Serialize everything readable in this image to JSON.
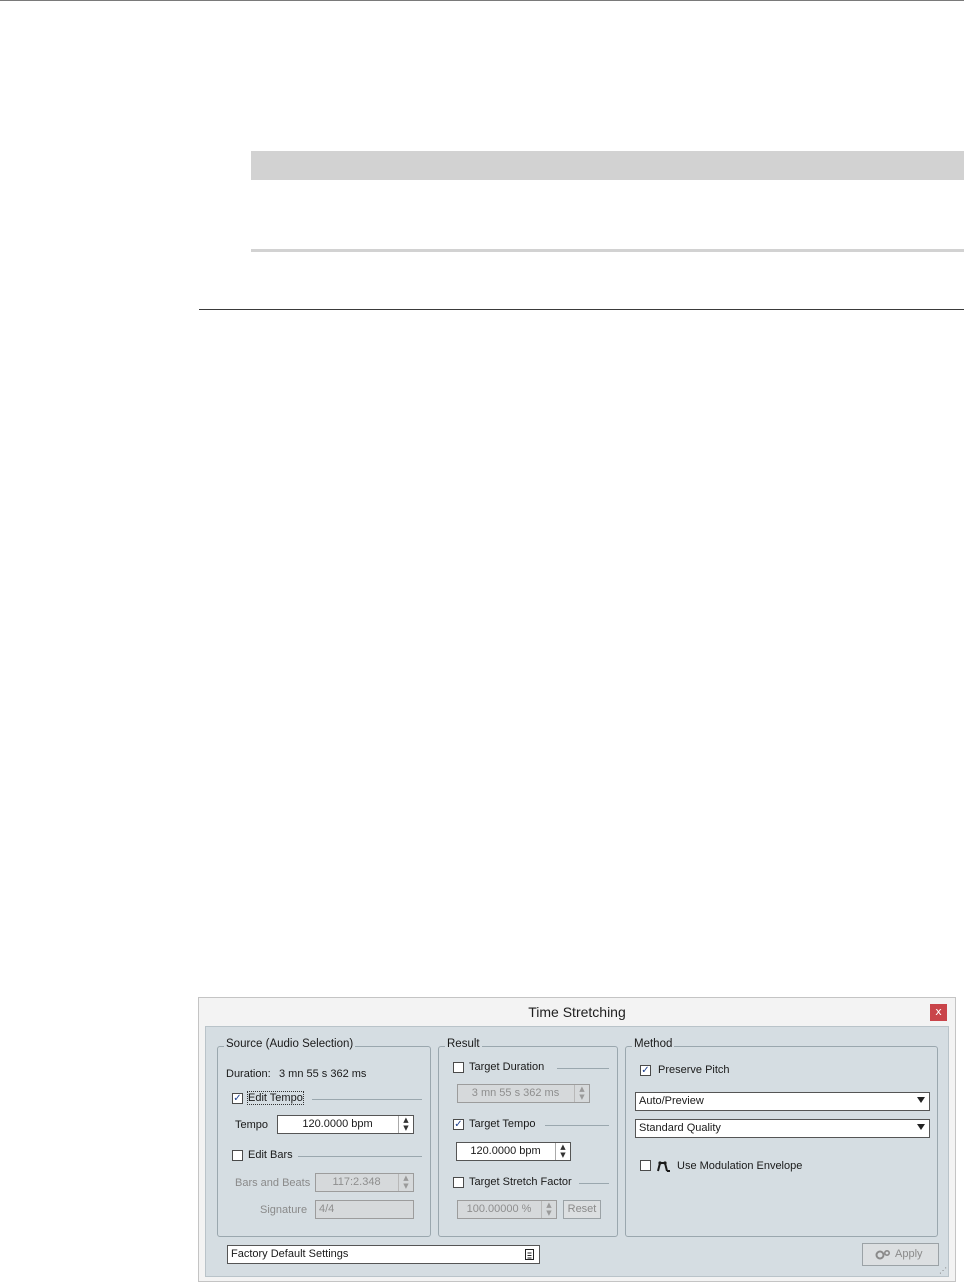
{
  "dialog": {
    "title": "Time Stretching",
    "close_label": "x",
    "source": {
      "title": "Source (Audio Selection)",
      "duration_label": "Duration:",
      "duration_value": "3 mn 55 s 362 ms",
      "edit_tempo_label": "Edit Tempo",
      "edit_tempo_checked": true,
      "tempo_label": "Tempo",
      "tempo_value": "120.0000 bpm",
      "edit_bars_label": "Edit Bars",
      "edit_bars_checked": false,
      "bars_beats_label": "Bars and Beats",
      "bars_beats_value": "117:2.348",
      "signature_label": "Signature",
      "signature_value": "4/4"
    },
    "result": {
      "title": "Result",
      "target_duration_label": "Target Duration",
      "target_duration_checked": false,
      "target_duration_value": "3 mn 55 s 362 ms",
      "target_tempo_label": "Target Tempo",
      "target_tempo_checked": true,
      "target_tempo_value": "120.0000 bpm",
      "target_stretch_label": "Target Stretch Factor",
      "target_stretch_checked": false,
      "target_stretch_value": "100.00000 %",
      "reset_label": "Reset"
    },
    "method": {
      "title": "Method",
      "preserve_pitch_label": "Preserve Pitch",
      "preserve_pitch_checked": true,
      "mode_value": "Auto/Preview",
      "quality_value": "Standard Quality",
      "modulation_label": "Use Modulation Envelope",
      "modulation_checked": false
    },
    "preset_value": "Factory Default Settings",
    "apply_label": "Apply"
  },
  "icons": {
    "check": "✓",
    "spin_up": "▲",
    "spin_down": "▼",
    "envelope": "envelope-icon",
    "preset": "preset-menu-icon",
    "gears": "gears-icon"
  }
}
